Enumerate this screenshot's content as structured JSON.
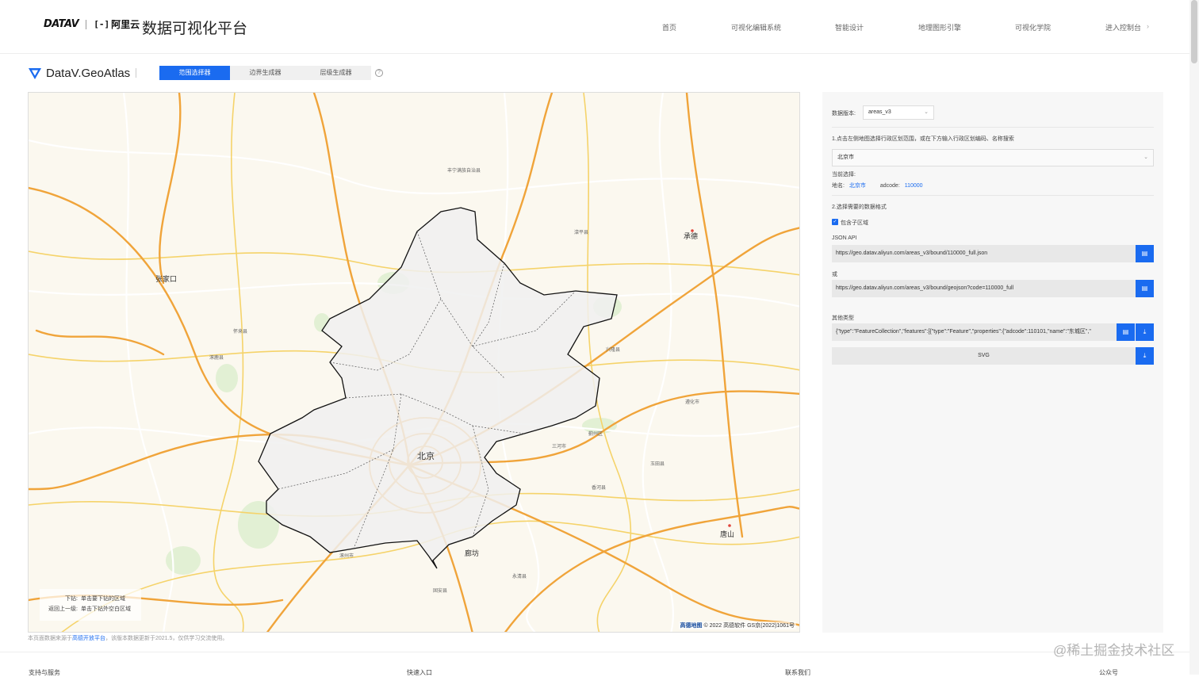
{
  "header": {
    "logo_datav": "DATAV",
    "logo_aliyun_mark": "[-]",
    "logo_aliyun": "阿里云",
    "platform_title": "数据可视化平台",
    "nav": [
      "首页",
      "可视化编辑系统",
      "智能设计",
      "地理图形引擎",
      "可视化学院",
      "进入控制台"
    ],
    "nav_more": "›"
  },
  "subheader": {
    "app_name": "DataV.GeoAtlas",
    "tabs": [
      "范围选择器",
      "边界生成器",
      "层级生成器"
    ],
    "active_tab": 0,
    "help": "?"
  },
  "map": {
    "labels": [
      {
        "text": "张家口"
      },
      {
        "text": "承德"
      },
      {
        "text": "北京"
      },
      {
        "text": "廊坊"
      },
      {
        "text": "唐山"
      },
      {
        "text": "丰宁满族自治县"
      },
      {
        "text": "滦平县"
      },
      {
        "text": "兴隆县"
      },
      {
        "text": "怀来县"
      },
      {
        "text": "涿鹿县"
      },
      {
        "text": "三河市"
      },
      {
        "text": "香河县"
      },
      {
        "text": "遵化市"
      },
      {
        "text": "玉田县"
      },
      {
        "text": "涿州市"
      },
      {
        "text": "固安县"
      },
      {
        "text": "永清县"
      },
      {
        "text": "蓟州区"
      }
    ],
    "hint": {
      "drill_key": "下钻:",
      "drill_val": "单击要下钻的区域",
      "back_key": "返回上一级:",
      "back_val": "单击下钻外空白区域"
    },
    "attribution_brand": "高德地图",
    "attribution": "© 2022 高德软件 GS京(2022)1061号"
  },
  "source_note": {
    "prefix": "本页面数据来源于",
    "link": "高德开放平台",
    "suffix": "，该版本数据更新于2021.5，仅供学习交流使用。"
  },
  "panel": {
    "version_label": "数据版本:",
    "version_value": "areas_v3",
    "step1": "1.点击左侧地图选择行政区划范围，或在下方输入行政区划编码、名称搜索",
    "region_value": "北京市",
    "current_label": "当前选择:",
    "name_label": "地名:",
    "name_value": "北京市",
    "adcode_label": "adcode:",
    "adcode_value": "110000",
    "step2": "2.选择需要的数据格式",
    "include_sub": "包含子区域",
    "include_sub_checked": true,
    "json_api_label": "JSON API",
    "json_api_url": "https://geo.datav.aliyun.com/areas_v3/bound/110000_full.json",
    "or_label": "或",
    "geojson_url": "https://geo.datav.aliyun.com/areas_v3/bound/geojson?code=110000_full",
    "other_label": "其他类型",
    "other_value": "{\"type\":\"FeatureCollection\",\"features\":[{\"type\":\"Feature\",\"properties\":{\"adcode\":110101,\"name\":\"东城区\",\"",
    "svg_label": "SVG"
  },
  "footer": {
    "cols": [
      "支持与服务",
      "快速入口",
      "联系我们",
      "公众号"
    ]
  },
  "watermark": "@稀土掘金技术社区"
}
